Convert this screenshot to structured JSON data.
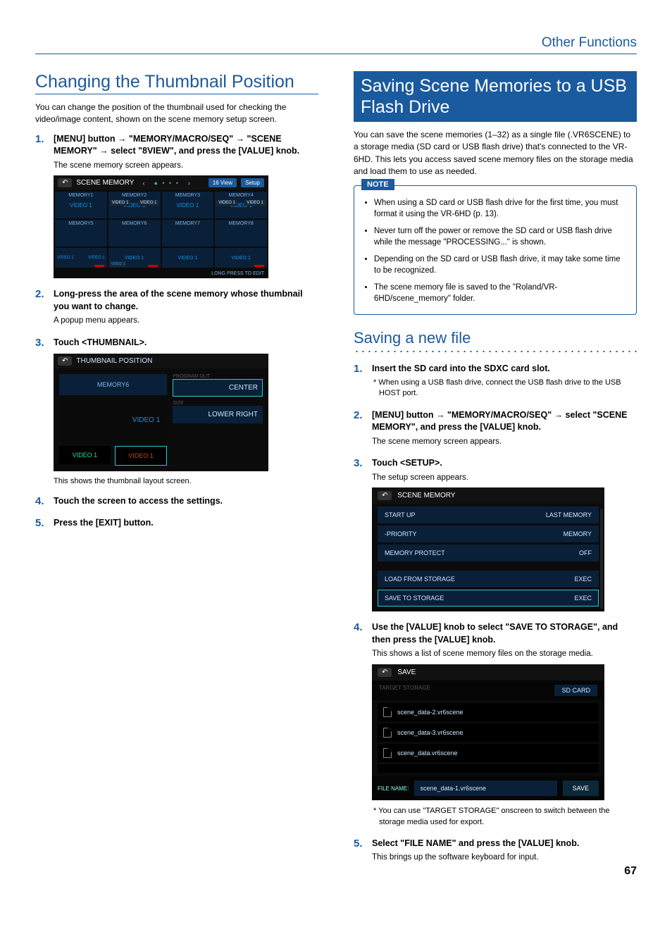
{
  "header": {
    "section": "Other Functions"
  },
  "page_number": "67",
  "left": {
    "title": "Changing the Thumbnail Position",
    "intro": "You can change the position of the thumbnail used for checking the video/image content, shown on the scene memory setup screen.",
    "steps": [
      {
        "head": "[MENU] button → \"MEMORY/MACRO/SEQ\" → \"SCENE MEMORY\" → select \"8VIEW\", and press the [VALUE] knob.",
        "sub": "The scene memory screen appears."
      },
      {
        "head": "Long-press the area of the scene memory whose thumbnail you want to change.",
        "sub": "A popup menu appears."
      },
      {
        "head": "Touch <THUMBNAIL>."
      },
      {
        "head": "Touch the screen to access the settings."
      },
      {
        "head": "Press the [EXIT] button."
      }
    ],
    "scenegrid": {
      "title": "SCENE MEMORY",
      "btn_16": "16 View",
      "btn_setup": "Setup",
      "cells": [
        "MEMORY1",
        "MEMORY2",
        "MEMORY3",
        "MEMORY4",
        "MEMORY5",
        "MEMORY6",
        "MEMORY7",
        "MEMORY8"
      ],
      "video_label": "VIDEO 1",
      "footer_note": "LONG PRESS TO EDIT"
    },
    "thumbpos": {
      "title": "THUMBNAIL POSITION",
      "memory_label": "MEMORY6",
      "video_label": "VIDEO 1",
      "vc1": "VIDEO 1",
      "vc2": "VIDEO 1",
      "lbl1": "PROGRAM OUT",
      "opt1": "CENTER",
      "lbl2": "SIZE",
      "opt2": "LOWER RIGHT"
    },
    "caption": "This shows the thumbnail layout screen."
  },
  "right": {
    "title": "Saving Scene Memories to a USB Flash Drive",
    "intro": "You can save the scene memories (1–32) as a single file (.VR6SCENE) to a storage media (SD card or USB flash drive) that's connected to the VR-6HD. This lets you access saved scene memory files on the storage media and load them to use as needed.",
    "note_label": "NOTE",
    "notes": [
      "When using a SD card or USB flash drive for the first time, you must format it using the VR-6HD (p. 13).",
      "Never turn off the power or remove the SD card or USB flash drive while the message \"PROCESSING...\" is shown.",
      "Depending on the SD card or USB flash drive, it may take some time to be recognized.",
      "The scene memory file is saved to the \"Roland/VR-6HD/scene_memory\" folder."
    ],
    "sub_title": "Saving a new file",
    "steps": [
      {
        "head": "Insert the SD card into the SDXC card slot.",
        "star": "* When using a USB flash drive, connect the USB flash drive to the USB HOST port."
      },
      {
        "head": "[MENU] button → \"MEMORY/MACRO/SEQ\" → select \"SCENE MEMORY\", and press the [VALUE] knob.",
        "sub": "The scene memory screen appears."
      },
      {
        "head": "Touch <SETUP>.",
        "sub": "The setup screen appears."
      },
      {
        "head": "Use the [VALUE] knob to select \"SAVE TO STORAGE\", and then press the [VALUE] knob.",
        "sub": "This shows a list of scene memory files on the storage media."
      },
      {
        "head": "Select \"FILE NAME\" and press the [VALUE] knob.",
        "sub": "This brings up the software keyboard for input."
      }
    ],
    "setup": {
      "title": "SCENE MEMORY",
      "rows": [
        {
          "l": "START UP",
          "r": "LAST MEMORY"
        },
        {
          "l": "-PRIORITY",
          "r": "MEMORY"
        },
        {
          "l": "MEMORY PROTECT",
          "r": "OFF"
        },
        {
          "l": "LOAD FROM STORAGE",
          "r": "EXEC"
        },
        {
          "l": "SAVE TO STORAGE",
          "r": "EXEC",
          "sel": true
        }
      ]
    },
    "save": {
      "title": "SAVE",
      "target_label": "TARGET STORAGE",
      "target_value": "SD CARD",
      "files": [
        "scene_data-2.vr6scene",
        "scene_data-3.vr6scene",
        "scene_data.vr6scene"
      ],
      "fn_label": "FILE NAME:",
      "fn_value": "scene_data-1.vr6scene",
      "save_btn": "SAVE"
    },
    "save_star": "* You can use \"TARGET STORAGE\" onscreen to switch between the storage media used for export."
  }
}
